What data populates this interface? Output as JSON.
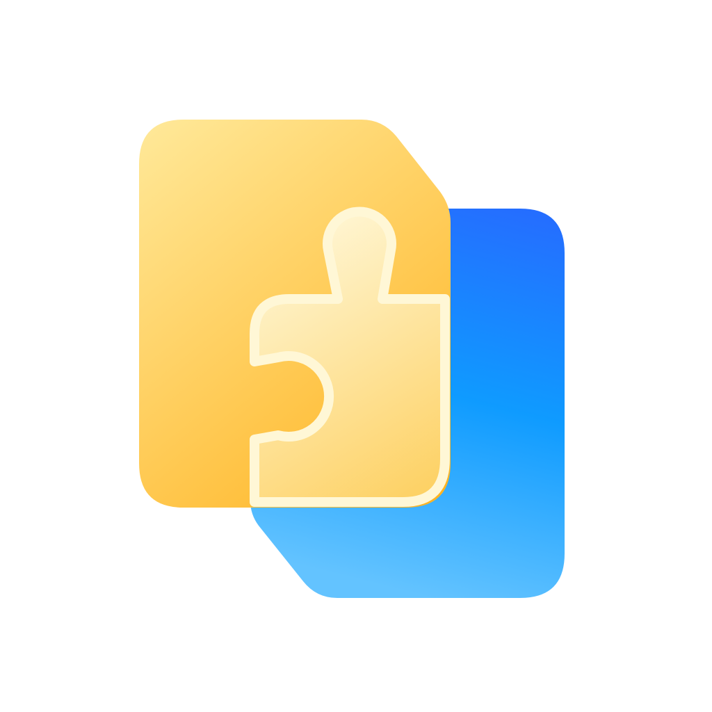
{
  "icon": {
    "name": "puzzle-files-app-icon",
    "colors": {
      "background": "#ffffff",
      "yellow_light": "#FFE99A",
      "yellow_dark": "#FFB21E",
      "blue_top": "#256DFF",
      "blue_mid": "#0F9BFF",
      "blue_bottom": "#63C3FF",
      "piece_light": "#FFF8DA",
      "piece_dark": "#FDCF5E",
      "piece_outline": "#FFF7D6"
    }
  }
}
